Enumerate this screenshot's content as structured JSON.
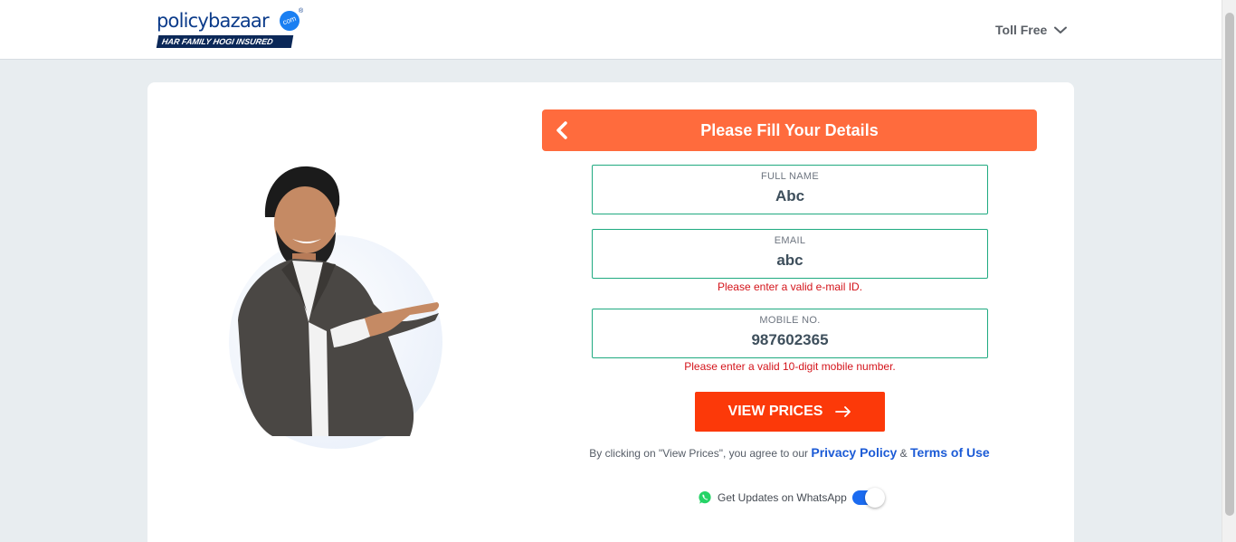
{
  "header": {
    "logo_text": "policybazaar",
    "logo_suffix": "com",
    "logo_reg": "®",
    "tagline": "HAR FAMILY HOGI INSURED",
    "toll_free_label": "Toll Free",
    "toll_free_icon": "chevron-down-icon"
  },
  "form": {
    "title": "Please Fill Your Details",
    "back_icon": "chevron-left-icon",
    "full_name": {
      "label": "FULL NAME",
      "value": "Abc"
    },
    "email": {
      "label": "EMAIL",
      "value": "abc",
      "error": "Please enter a valid e-mail ID."
    },
    "mobile": {
      "label": "MOBILE NO.",
      "value": "987602365",
      "error": "Please enter a valid 10-digit mobile number."
    },
    "submit_label": "VIEW PRICES",
    "submit_icon": "arrow-right-icon",
    "terms_prefix": "By clicking on \"View Prices\", you agree to our",
    "privacy_link": "Privacy Policy",
    "terms_joiner": "&",
    "terms_link": "Terms of Use",
    "whatsapp_label": "Get Updates on WhatsApp",
    "whatsapp_icon": "whatsapp-icon",
    "whatsapp_toggle_on": true
  },
  "colors": {
    "brand_navy": "#0b3b8a",
    "header_orange": "#ff6b3d",
    "cta_red": "#fc3909",
    "field_border": "#1faa80",
    "error_red": "#d4141b",
    "link_blue": "#1c5bd6",
    "toggle_blue": "#1b6bf0"
  }
}
